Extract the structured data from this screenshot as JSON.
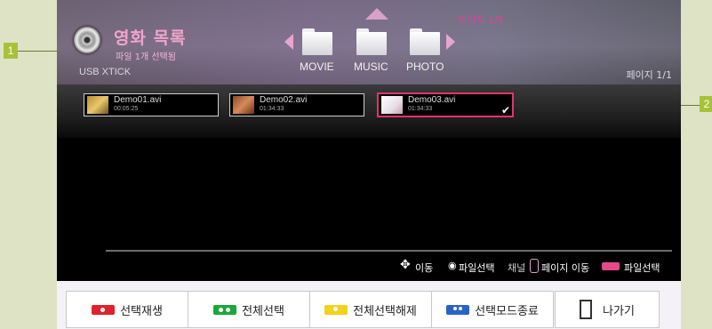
{
  "callouts": [
    "1",
    "2"
  ],
  "header": {
    "title": "영화 목록",
    "subtitle": "파일 1개 선택됨",
    "device": "USB XTICK",
    "page_top": "페이지 1/1",
    "page_right": "페이지 1/1"
  },
  "categories": [
    {
      "label": "MOVIE",
      "icon": "folder-icon"
    },
    {
      "label": "MUSIC",
      "icon": "folder-icon"
    },
    {
      "label": "PHOTO",
      "icon": "folder-icon"
    }
  ],
  "files": [
    {
      "name": "Demo01.avi",
      "duration": "00:05:25",
      "selected": false
    },
    {
      "name": "Demo02.avi",
      "duration": "01:34:33",
      "selected": false
    },
    {
      "name": "Demo03.avi",
      "duration": "01:34:33",
      "selected": true
    }
  ],
  "help": {
    "move": "이동",
    "select_file": "파일선택",
    "channel": "채널",
    "page_move": "페이지 이동",
    "select_file2": "파일선택"
  },
  "buttons": [
    {
      "label": "선택재생",
      "color": "#e0202a"
    },
    {
      "label": "전체선택",
      "color": "#1aa83a"
    },
    {
      "label": "전체선택해제",
      "color": "#f2d21a"
    },
    {
      "label": "선택모드종료",
      "color": "#2a63c8"
    },
    {
      "label": "나가기",
      "color": "#ffffff"
    }
  ],
  "colors": {
    "accent": "#e4336f",
    "title": "#f0a5cc"
  }
}
